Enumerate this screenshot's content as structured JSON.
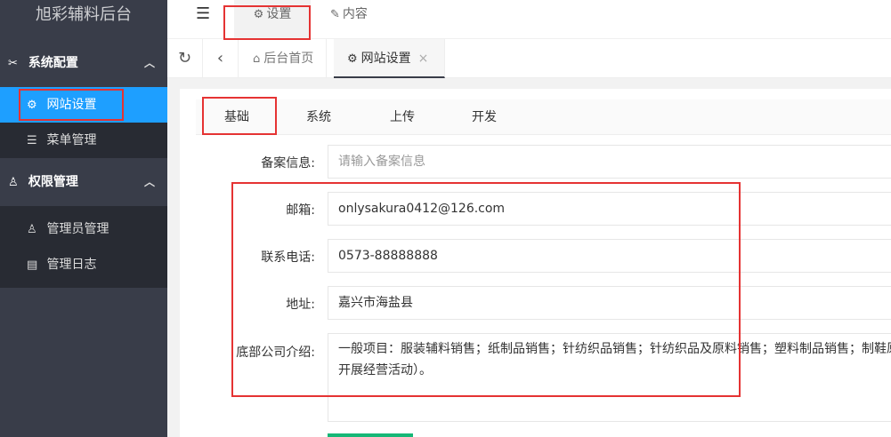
{
  "app": {
    "title": "旭彩辅料后台"
  },
  "sidebar": {
    "groups": [
      {
        "label": "系统配置",
        "icon": "tools-icon",
        "expanded": true,
        "items": [
          {
            "label": "网站设置",
            "icon": "gear-icon",
            "active": true
          },
          {
            "label": "菜单管理",
            "icon": "list-icon",
            "active": false
          }
        ]
      },
      {
        "label": "权限管理",
        "icon": "user-key-icon",
        "expanded": true,
        "items": [
          {
            "label": "管理员管理",
            "icon": "user-icon",
            "active": false
          },
          {
            "label": "管理日志",
            "icon": "log-icon",
            "active": false
          }
        ]
      }
    ]
  },
  "header": {
    "tabs": [
      {
        "label": "设置",
        "icon": "gear-icon",
        "active": true
      },
      {
        "label": "内容",
        "icon": "edit-icon",
        "active": false
      }
    ]
  },
  "tabstrip": {
    "tabs": [
      {
        "label": "后台首页",
        "icon": "home-icon",
        "active": false
      },
      {
        "label": "网站设置",
        "icon": "gear-icon",
        "active": true,
        "close": "×"
      }
    ]
  },
  "settings": {
    "tabs": [
      "基础",
      "系统",
      "上传",
      "开发"
    ],
    "fields": {
      "icp": {
        "label": "备案信息:",
        "value": "",
        "placeholder": "请输入备案信息"
      },
      "email": {
        "label": "邮箱:",
        "value": "onlysakura0412@126.com"
      },
      "phone": {
        "label": "联系电话:",
        "value": "0573-88888888"
      },
      "address": {
        "label": "地址:",
        "value": "嘉兴市海盐县"
      },
      "intro": {
        "label": "底部公司介绍:",
        "line1": "一般项目：服装辅料销售；纸制品销售；针纺织品销售；针纺织品及原料销售；塑料制品销售；制鞋原",
        "line2": "开展经营活动）。"
      }
    }
  },
  "colors": {
    "sidebar_bg": "#393d49",
    "active_blue": "#1e9fff",
    "annotation_red": "#e53333",
    "accent_green": "#16b777"
  }
}
